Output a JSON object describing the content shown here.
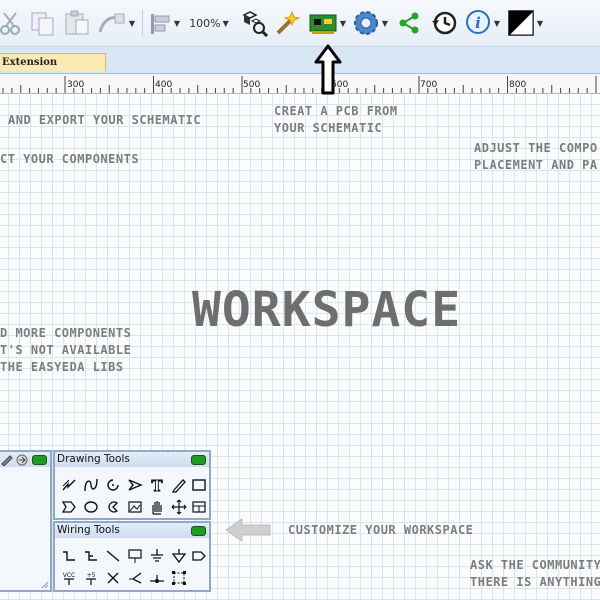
{
  "toolbar": {
    "zoom_label": "100%",
    "items": [
      "cut-icon",
      "copy-icon",
      "paste-icon",
      "format-painter-icon",
      "align-icon",
      "zoom-dropdown",
      "find-components-icon",
      "magic-wand-icon",
      "convert-to-pcb-icon",
      "settings-icon",
      "share-icon",
      "history-icon",
      "help-icon",
      "theme-toggle-icon"
    ]
  },
  "tabs": [
    {
      "label": "Extension"
    }
  ],
  "ruler": {
    "labels": [
      "300",
      "400",
      "500",
      "600",
      "700",
      "800"
    ]
  },
  "workspace": {
    "title": "WORKSPACE",
    "hints": {
      "export": "AND EXPORT YOUR SCHEMATIC",
      "pcb_line1": "CREAT A PCB FROM",
      "pcb_line2": "YOUR SCHEMATIC",
      "components": "CT YOUR COMPONENTS",
      "adjust_line1": "ADJUST THE COMPO",
      "adjust_line2": "PLACEMENT AND PA",
      "more_line1": "D MORE COMPONENTS",
      "more_line2": "T'S NOT AVAILABLE",
      "more_line3": "THE EASYEDA LIBS",
      "customize": "CUSTOMIZE YOUR WORKSPACE",
      "community_line1": "ASK THE COMMUNITY",
      "community_line2": "THERE IS ANYTHING"
    }
  },
  "panels": {
    "drawing": {
      "title": "Drawing Tools"
    },
    "wiring": {
      "title": "Wiring Tools"
    }
  },
  "colors": {
    "accent": "#2f6fb0",
    "pcb_green": "#2e8b2e",
    "minimize_green": "#1e9b22"
  }
}
